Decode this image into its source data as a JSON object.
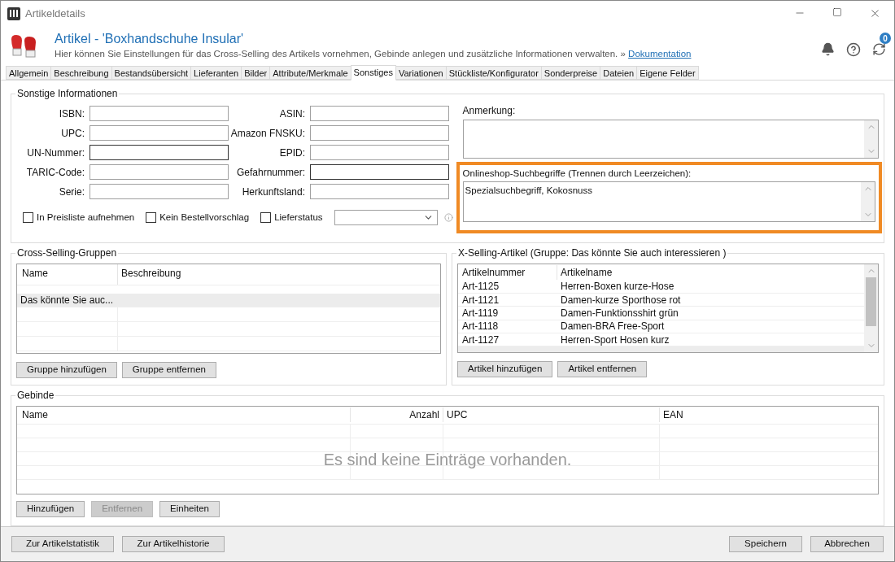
{
  "window": {
    "title": "Artikeldetails"
  },
  "header": {
    "title": "Artikel - 'Boxhandschuhe Insular'",
    "subtitle": "Hier können Sie Einstellungen für das Cross-Selling des Artikels vornehmen, Gebinde anlegen und zusätzliche Informationen verwalten. »",
    "link": "Dokumentation",
    "badge": "0"
  },
  "tabs": [
    {
      "label": "Allgemein",
      "selected": false
    },
    {
      "label": "Beschreibung",
      "selected": false
    },
    {
      "label": "Bestandsübersicht",
      "selected": false
    },
    {
      "label": "Lieferanten",
      "selected": false
    },
    {
      "label": "Bilder",
      "selected": false
    },
    {
      "label": "Attribute/Merkmale",
      "selected": false
    },
    {
      "label": "Sonstiges",
      "selected": true
    },
    {
      "label": "Variationen",
      "selected": false
    },
    {
      "label": "Stückliste/Konfigurator",
      "selected": false
    },
    {
      "label": "Sonderpreise",
      "selected": false
    },
    {
      "label": "Dateien",
      "selected": false
    },
    {
      "label": "Eigene Felder",
      "selected": false
    }
  ],
  "info": {
    "title": "Sonstige Informationen",
    "fields_left": [
      {
        "label": "ISBN:",
        "focused": false
      },
      {
        "label": "UPC:",
        "focused": false
      },
      {
        "label": "UN-Nummer:",
        "focused": true
      },
      {
        "label": "TARIC-Code:",
        "focused": false
      },
      {
        "label": "Serie:",
        "focused": false
      }
    ],
    "fields_right": [
      {
        "label": "ASIN:",
        "focused": false
      },
      {
        "label": "Amazon FNSKU:",
        "focused": false
      },
      {
        "label": "EPID:",
        "focused": false
      },
      {
        "label": "Gefahrnummer:",
        "focused": true
      },
      {
        "label": "Herkunftsland:",
        "focused": false
      }
    ],
    "checkboxes": [
      {
        "label": "In Preisliste aufnehmen",
        "checked": false
      },
      {
        "label": "Kein Bestellvorschlag",
        "checked": false
      },
      {
        "label": "Lieferstatus",
        "checked": false
      }
    ],
    "note_label": "Anmerkung:",
    "search_label": "Onlineshop-Suchbegriffe (Trennen durch Leerzeichen):",
    "search_value": "Spezialsuchbegriff, Kokosnuss"
  },
  "cross_selling": {
    "title": "Cross-Selling-Gruppen",
    "columns": [
      "Name",
      "Beschreibung"
    ],
    "rows": [
      {
        "name": "Das könnte Sie auc...",
        "selected": true
      }
    ],
    "buttons": [
      "Gruppe hinzufügen",
      "Gruppe entfernen"
    ]
  },
  "x_selling": {
    "title": "X-Selling-Artikel (Gruppe: Das könnte Sie auch interessieren )",
    "columns": [
      "Artikelnummer",
      "Artikelname"
    ],
    "rows": [
      {
        "number": "Art-1125",
        "name": "Herren-Boxen kurze-Hose"
      },
      {
        "number": "Art-1121",
        "name": "Damen-kurze Sporthose rot"
      },
      {
        "number": "Art-1119",
        "name": "Damen-Funktionsshirt grün"
      },
      {
        "number": "Art-1118",
        "name": "Damen-BRA Free-Sport"
      },
      {
        "number": "Art-1127",
        "name": "Herren-Sport Hosen kurz"
      }
    ],
    "buttons": [
      "Artikel hinzufügen",
      "Artikel entfernen"
    ]
  },
  "gebinde": {
    "title": "Gebinde",
    "columns": [
      "Name",
      "Anzahl",
      "UPC",
      "EAN"
    ],
    "empty_text": "Es sind keine Einträge vorhanden.",
    "buttons": [
      {
        "label": "Hinzufügen",
        "disabled": false
      },
      {
        "label": "Entfernen",
        "disabled": true
      },
      {
        "label": "Einheiten",
        "disabled": false
      }
    ]
  },
  "footer": {
    "left": [
      "Zur Artikelstatistik",
      "Zur Artikelhistorie"
    ],
    "right": [
      "Speichern",
      "Abbrechen"
    ]
  }
}
